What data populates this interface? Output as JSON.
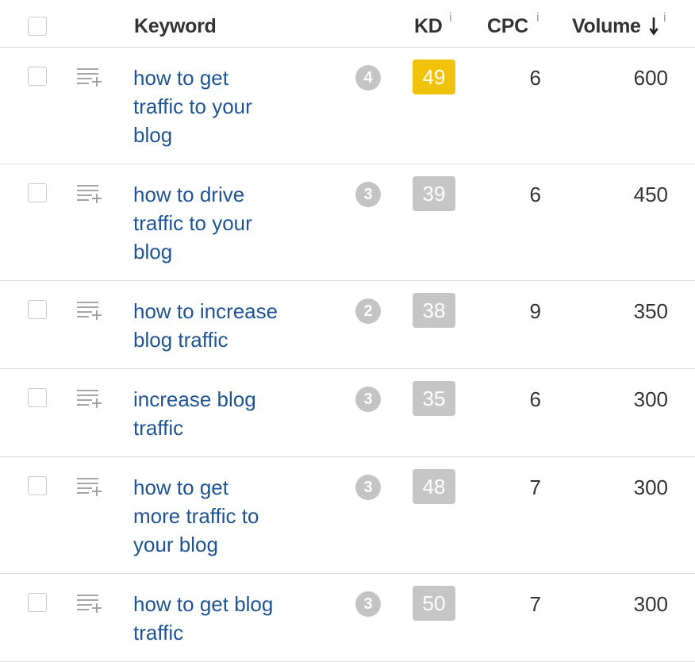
{
  "header": {
    "keyword_label": "Keyword",
    "kd_label": "KD",
    "cpc_label": "CPC",
    "volume_label": "Volume",
    "info_glyph": "i"
  },
  "colors": {
    "link": "#1e5494",
    "kd_high": "#f0c30a",
    "kd_normal": "#c6c6c6",
    "serp_badge": "#c4c4c4"
  },
  "icons": {
    "add_to_list": "add-to-list-icon",
    "sort": "sort-down-arrow-icon",
    "info": "info-icon"
  },
  "rows": [
    {
      "keyword": "how to get traffic to your blog",
      "lines": [
        "how to get",
        "traffic to your",
        "blog"
      ],
      "serp": "4",
      "kd": "49",
      "kd_high": true,
      "cpc": "6",
      "volume": "600"
    },
    {
      "keyword": "how to drive traffic to your blog",
      "lines": [
        "how to drive",
        "traffic to your",
        "blog"
      ],
      "serp": "3",
      "kd": "39",
      "kd_high": false,
      "cpc": "6",
      "volume": "450"
    },
    {
      "keyword": "how to increase blog traffic",
      "lines": [
        "how to increase",
        "blog traffic"
      ],
      "serp": "2",
      "kd": "38",
      "kd_high": false,
      "cpc": "9",
      "volume": "350"
    },
    {
      "keyword": "increase blog traffic",
      "lines": [
        "increase blog",
        "traffic"
      ],
      "serp": "3",
      "kd": "35",
      "kd_high": false,
      "cpc": "6",
      "volume": "300"
    },
    {
      "keyword": "how to get more traffic to your blog",
      "lines": [
        "how to get",
        "more traffic to",
        "your blog"
      ],
      "serp": "3",
      "kd": "48",
      "kd_high": false,
      "cpc": "7",
      "volume": "300"
    },
    {
      "keyword": "how to get blog traffic",
      "lines": [
        "how to get blog",
        "traffic"
      ],
      "serp": "3",
      "kd": "50",
      "kd_high": false,
      "cpc": "7",
      "volume": "300"
    }
  ]
}
